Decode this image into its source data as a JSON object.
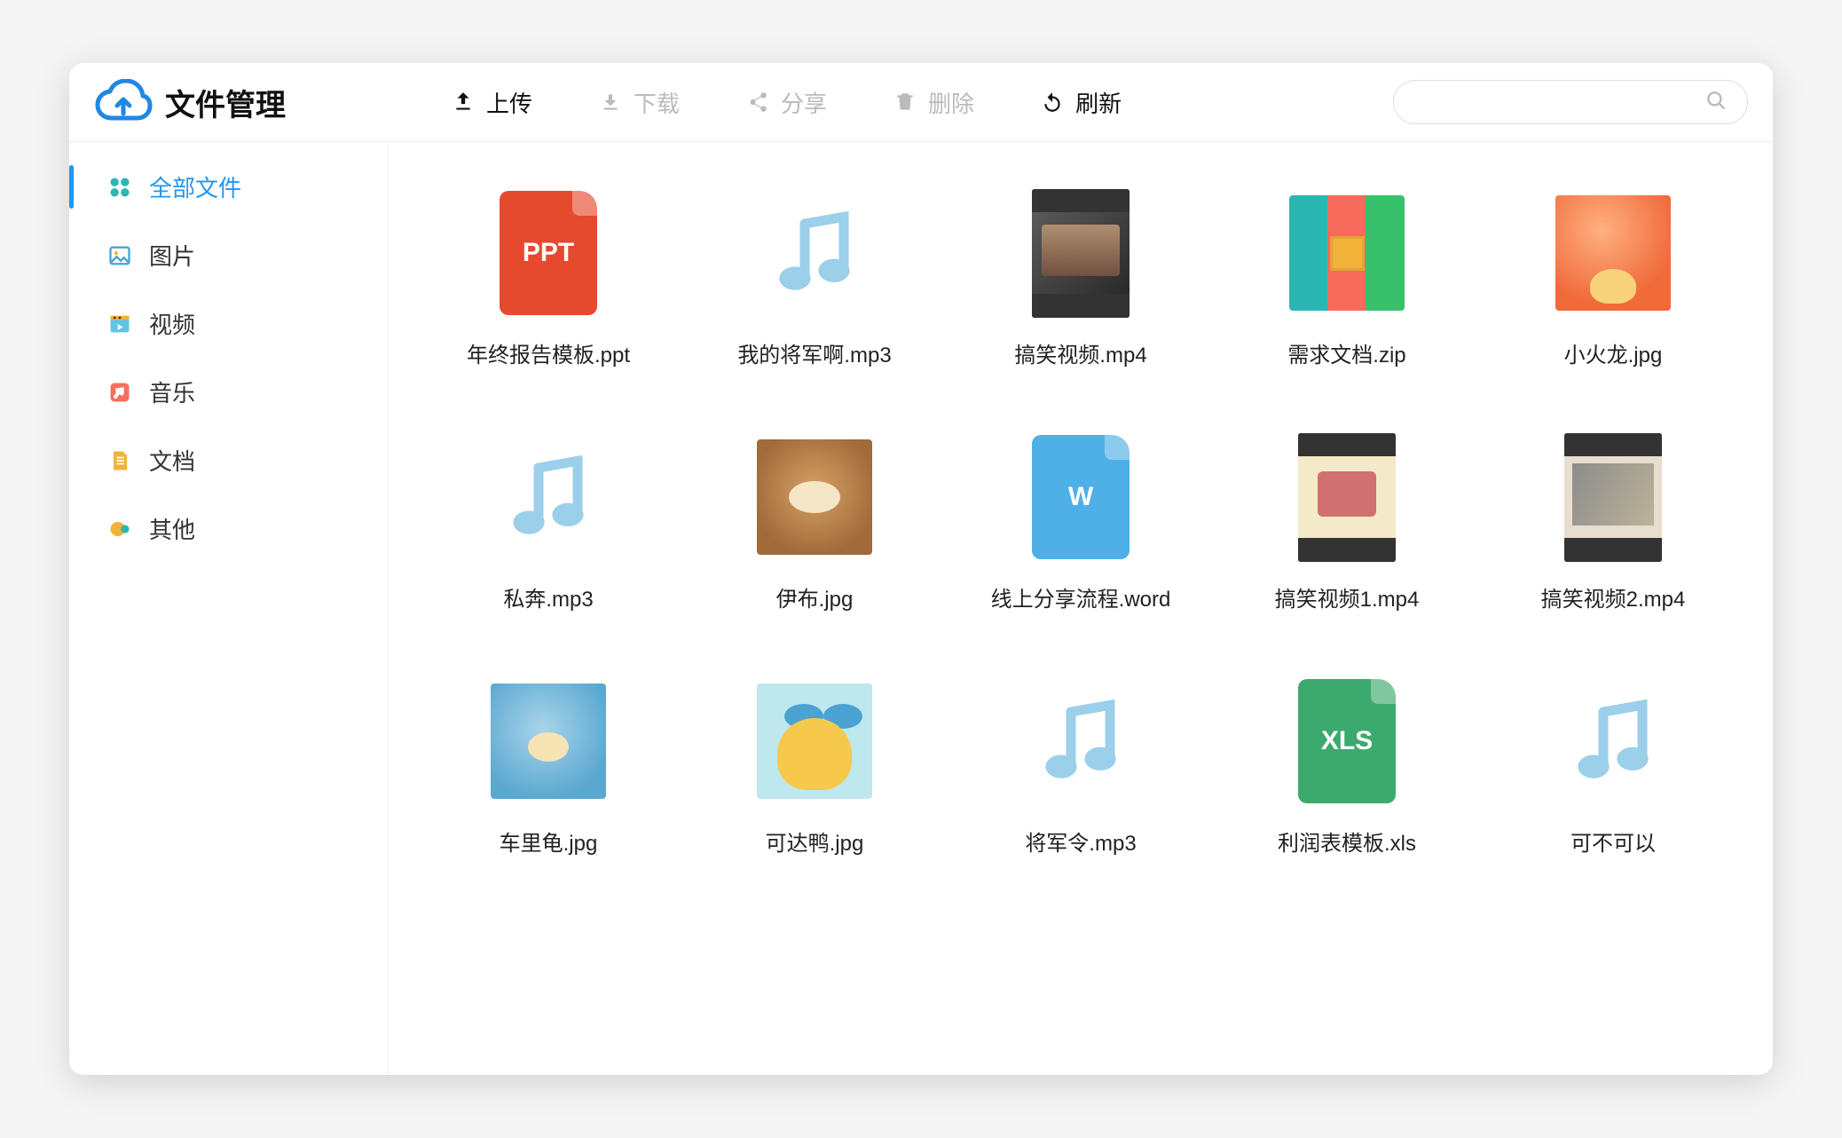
{
  "header": {
    "app_title": "文件管理",
    "toolbar": {
      "upload": {
        "label": "上传",
        "enabled": true
      },
      "download": {
        "label": "下载",
        "enabled": false
      },
      "share": {
        "label": "分享",
        "enabled": false
      },
      "delete": {
        "label": "删除",
        "enabled": false
      },
      "refresh": {
        "label": "刷新",
        "enabled": true
      }
    },
    "search_placeholder": ""
  },
  "sidebar": {
    "items": [
      {
        "label": "全部文件",
        "active": true
      },
      {
        "label": "图片",
        "active": false
      },
      {
        "label": "视频",
        "active": false
      },
      {
        "label": "音乐",
        "active": false
      },
      {
        "label": "文档",
        "active": false
      },
      {
        "label": "其他",
        "active": false
      }
    ]
  },
  "files": [
    {
      "name": "年终报告模板.ppt",
      "kind": "ppt"
    },
    {
      "name": "我的将军啊.mp3",
      "kind": "audio"
    },
    {
      "name": "搞笑视频.mp4",
      "kind": "video1"
    },
    {
      "name": "需求文档.zip",
      "kind": "zip"
    },
    {
      "name": "小火龙.jpg",
      "kind": "img-char"
    },
    {
      "name": "私奔.mp3",
      "kind": "audio"
    },
    {
      "name": "伊布.jpg",
      "kind": "img-eevee"
    },
    {
      "name": "线上分享流程.word",
      "kind": "word"
    },
    {
      "name": "搞笑视频1.mp4",
      "kind": "video2"
    },
    {
      "name": "搞笑视频2.mp4",
      "kind": "video3"
    },
    {
      "name": "车里龟.jpg",
      "kind": "img-squirtle"
    },
    {
      "name": "可达鸭.jpg",
      "kind": "img-psyduck"
    },
    {
      "name": "将军令.mp3",
      "kind": "audio"
    },
    {
      "name": "利润表模板.xls",
      "kind": "xls"
    },
    {
      "name": "可不可以",
      "kind": "audio"
    }
  ],
  "doc_badges": {
    "ppt": "PPT",
    "word": "W",
    "xls": "XLS"
  }
}
